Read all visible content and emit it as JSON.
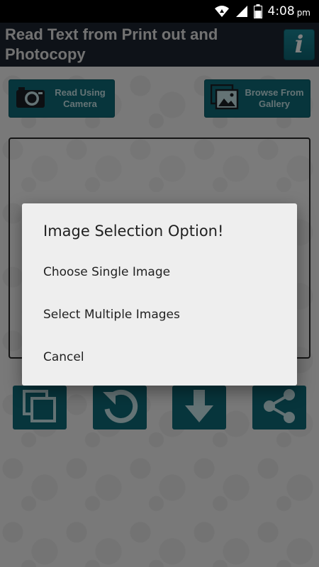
{
  "status_bar": {
    "time": "4:08",
    "ampm": "pm",
    "icons": [
      "wifi-icon",
      "signal-icon",
      "battery-icon"
    ]
  },
  "app_bar": {
    "title": "Read Text from Print out and Photocopy",
    "info_icon": "i"
  },
  "actions": {
    "camera_label": "Read Using Camera",
    "gallery_label": "Browse From Gallery"
  },
  "toolbar": {
    "icons": [
      "copy-icon",
      "rotate-icon",
      "download-icon",
      "share-icon"
    ]
  },
  "dialog": {
    "title": "Image Selection Option!",
    "options": [
      "Choose Single Image",
      "Select Multiple Images",
      "Cancel"
    ]
  },
  "colors": {
    "accent": "#0f6b78",
    "app_bar": "#1d2530",
    "dialog_bg": "#eeeeee"
  }
}
